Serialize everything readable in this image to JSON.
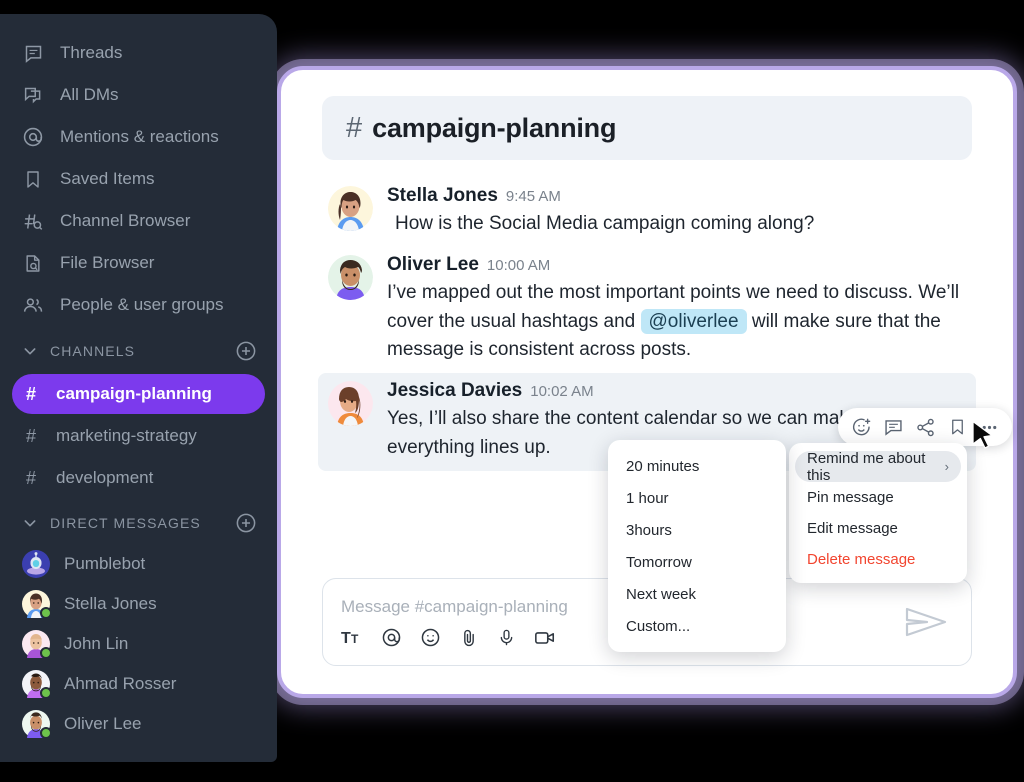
{
  "sidebar": {
    "nav": [
      {
        "label": "Threads",
        "icon": "threads-icon"
      },
      {
        "label": "All DMs",
        "icon": "all-dms-icon"
      },
      {
        "label": "Mentions & reactions",
        "icon": "at-mention-icon"
      },
      {
        "label": "Saved Items",
        "icon": "bookmark-icon"
      },
      {
        "label": "Channel Browser",
        "icon": "channel-browser-icon"
      },
      {
        "label": "File Browser",
        "icon": "file-browser-icon"
      },
      {
        "label": "People & user groups",
        "icon": "people-icon"
      }
    ],
    "channels_section": {
      "label": "CHANNELS",
      "add_label": "+"
    },
    "channels": [
      {
        "name": "campaign-planning",
        "active": true
      },
      {
        "name": "marketing-strategy",
        "active": false
      },
      {
        "name": "development",
        "active": false
      }
    ],
    "dm_section": {
      "label": "DIRECT MESSAGES",
      "add_label": "+"
    },
    "dms": [
      {
        "name": "Pumblebot",
        "online": false
      },
      {
        "name": "Stella Jones",
        "online": true
      },
      {
        "name": "John Lin",
        "online": true
      },
      {
        "name": "Ahmad Rosser",
        "online": true
      },
      {
        "name": "Oliver Lee",
        "online": true
      }
    ],
    "accent_color": "#7c3aed",
    "background_color": "#242c38"
  },
  "channel_header": {
    "hash": "#",
    "name": "campaign-planning"
  },
  "messages": [
    {
      "author": "Stella Jones",
      "time": "9:45 AM",
      "text": "How is the Social Media campaign coming along?",
      "indent": true,
      "highlight": false
    },
    {
      "author": "Oliver Lee",
      "time": "10:00 AM",
      "text_before": "I’ve mapped out the most important points we need to discuss. We’ll cover the usual hashtags and",
      "mention": "@oliverlee",
      "text_after": "will make sure that the message is consistent across posts.",
      "indent": false,
      "highlight": false
    },
    {
      "author": "Jessica Davies",
      "time": "10:02 AM",
      "text": "Yes, I’ll also share the content calendar so we can make sure everything lines up.",
      "indent": false,
      "highlight": true
    }
  ],
  "action_bar": {
    "buttons": [
      {
        "name": "add-reaction-icon"
      },
      {
        "name": "reply-in-thread-icon"
      },
      {
        "name": "share-message-icon"
      },
      {
        "name": "save-message-icon"
      },
      {
        "name": "more-actions-icon"
      }
    ]
  },
  "context_menu": {
    "items": [
      {
        "label": "Remind me about this",
        "selected": true,
        "has_submenu": true,
        "chevron": "›",
        "danger": false
      },
      {
        "label": "Pin message",
        "selected": false,
        "has_submenu": false,
        "chevron": "",
        "danger": false
      },
      {
        "label": "Edit message",
        "selected": false,
        "has_submenu": false,
        "chevron": "",
        "danger": false
      },
      {
        "label": "Delete message",
        "selected": false,
        "has_submenu": false,
        "chevron": "",
        "danger": true
      }
    ],
    "danger_color": "#f2452f"
  },
  "reminder_submenu": {
    "items": [
      {
        "label": "20 minutes"
      },
      {
        "label": "1 hour"
      },
      {
        "label": "3hours"
      },
      {
        "label": "Tomorrow"
      },
      {
        "label": "Next week"
      },
      {
        "label": "Custom..."
      }
    ]
  },
  "composer": {
    "placeholder": "Message #campaign-planning",
    "value": "",
    "tools": [
      {
        "name": "text-format-icon",
        "glyph": "Tt"
      },
      {
        "name": "mention-icon",
        "glyph": "@"
      },
      {
        "name": "emoji-icon",
        "glyph": "☺"
      },
      {
        "name": "attachment-icon",
        "glyph": "📎"
      },
      {
        "name": "microphone-icon",
        "glyph": "mic"
      },
      {
        "name": "video-icon",
        "glyph": "video"
      }
    ],
    "send_label": "Send"
  }
}
